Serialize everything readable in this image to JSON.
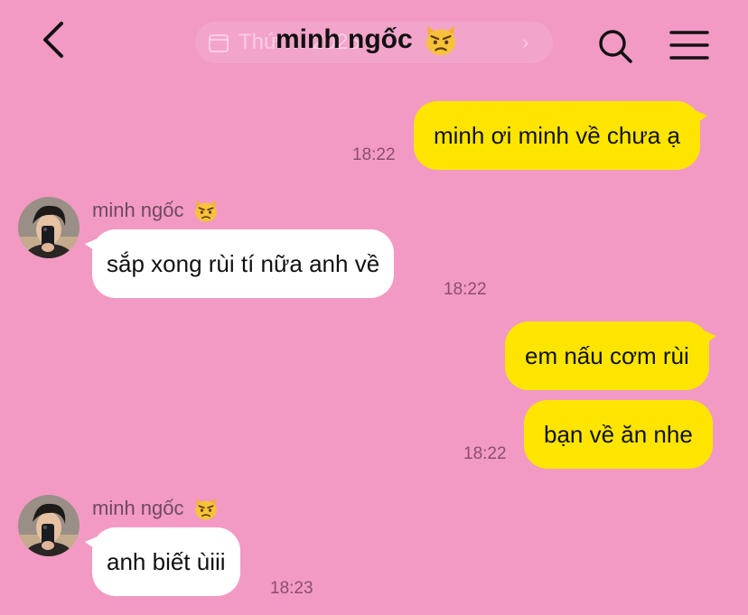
{
  "header": {
    "title": "minh ngốc",
    "title_emoji": "pouting-cat-emoji",
    "date_pill_text": "Thứ … 2025",
    "back_icon": "chevron-left-icon",
    "search_icon": "search-icon",
    "menu_icon": "hamburger-menu-icon"
  },
  "colors": {
    "background": "#f29ac4",
    "my_bubble": "#fde500",
    "their_bubble": "#ffffff",
    "timestamp": "#8a4f68"
  },
  "messages": [
    {
      "from": "me",
      "text": "minh ơi minh về chưa ạ",
      "time": "18:22"
    },
    {
      "from": "them",
      "sender": "minh ngốc",
      "text": "sắp xong rùi tí nữa anh về",
      "time": "18:22"
    },
    {
      "from": "me",
      "text": "em nấu cơm rùi",
      "time": ""
    },
    {
      "from": "me",
      "text": "bạn về ăn nhe",
      "time": "18:22"
    },
    {
      "from": "them",
      "sender": "minh ngốc",
      "text": "anh biết ùiii",
      "time": "18:23"
    }
  ]
}
